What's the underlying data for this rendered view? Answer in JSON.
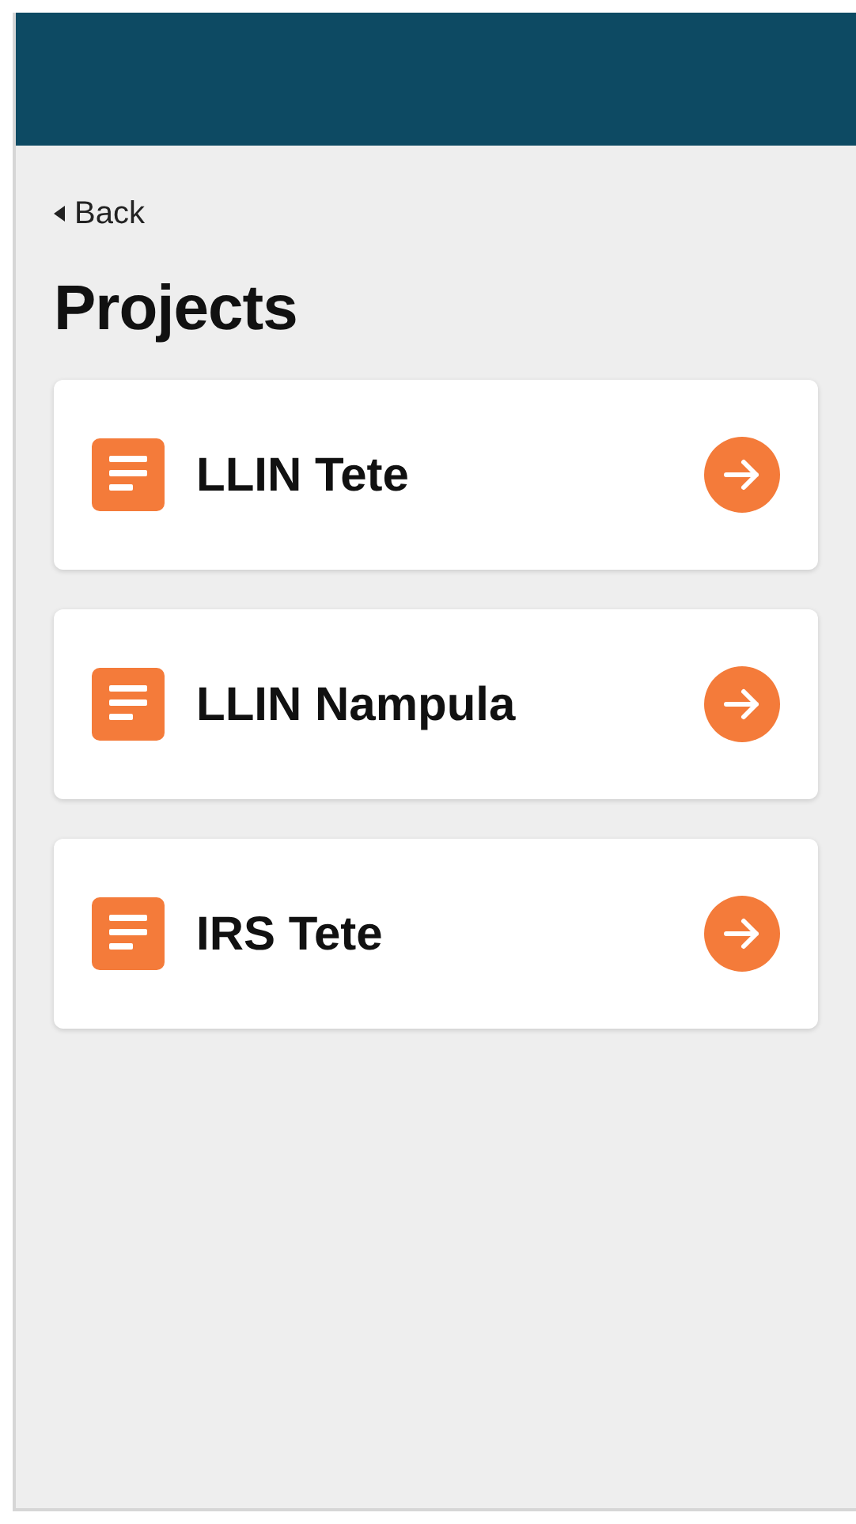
{
  "back": {
    "label": "Back"
  },
  "title": "Projects",
  "projects": [
    {
      "name": "LLIN Tete"
    },
    {
      "name": "LLIN Nampula"
    },
    {
      "name": "IRS Tete"
    }
  ]
}
